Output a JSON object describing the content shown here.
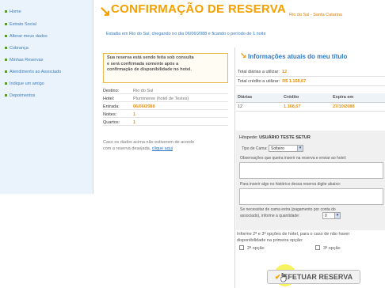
{
  "colors": {
    "accent": "#f5a000",
    "link": "#2f78c4",
    "highlight": "#e8900a"
  },
  "sidebar": {
    "items": [
      {
        "label": "Home"
      },
      {
        "label": "Extrato Social"
      },
      {
        "label": "Alterar meus dados"
      },
      {
        "label": "Cobrança"
      },
      {
        "label": "Minhas Reservas"
      },
      {
        "label": "Atendimento ao Associado"
      },
      {
        "label": "Indique um amigo"
      },
      {
        "label": "Depoimentos"
      }
    ]
  },
  "header": {
    "title": "CONFIRMAÇÃO DE RESERVA",
    "location": "Rio do Sul - Santa Catarina",
    "subtitle": "Estadia em Rio do Sul, chegando no dia 06/06/2088 e ficando o período de 1 noite"
  },
  "notice": {
    "line1": "Sua reserva está sendo feita sob consulta",
    "line2": "e será confirmada somente após a",
    "line3": "confirmação de disponibilidade no hotel."
  },
  "details": {
    "destino_label": "Destino:",
    "destino_value": "Rio do Sul",
    "hotel_label": "Hotel:",
    "hotel_value": "Plummeree (hotel de Testes)",
    "entrada_label": "Entrada:",
    "entrada_value": "06/06/2088",
    "noites_label": "Noites:",
    "noites_value": "1",
    "quartos_label": "Quartos:",
    "quartos_value": "1"
  },
  "disclaimer": {
    "line1": "Caso os dados acima não estiverem de acordo",
    "line2": "com a reserva desejada,",
    "link": "clique aqui"
  },
  "panel": {
    "title": "Informações atuais do meu título",
    "total_diarias_label": "Total diárias a utilizar:",
    "total_diarias_value": "12",
    "total_credito_label": "Total crédito a utilizar:",
    "total_credito_value": "R$ 1.168,67",
    "table": {
      "headers": [
        "Diárias",
        "Crédito",
        "Expira em"
      ],
      "row": [
        "12",
        "1.168,67",
        "27/10/2088"
      ]
    }
  },
  "form": {
    "guest_label": "Hóspede:",
    "guest_name": "USUÁRIO TESTE SETUR",
    "bed_label": "Tipo de Cama:",
    "bed_value": "Solteiro",
    "obs_label": "Observações que queira inserir na reserva e enviar ao hotel:",
    "internal_label": "Para inserir algo no histórico dessa reserva digite abaixo:",
    "extra_label_1": "Se necessitar de cama extra (pagamento por conta do",
    "extra_label_2": "associado), informe a quantidade:",
    "extra_value": "0"
  },
  "options": {
    "line1": "Informe 2ª e 3ª opções de hotel, para o caso de não haver",
    "line2": "disponibilidade na primeira opção:",
    "option2": "2ª opção",
    "option3": "3ª opção"
  },
  "submit": {
    "label": "EFETUAR RESERVA"
  }
}
